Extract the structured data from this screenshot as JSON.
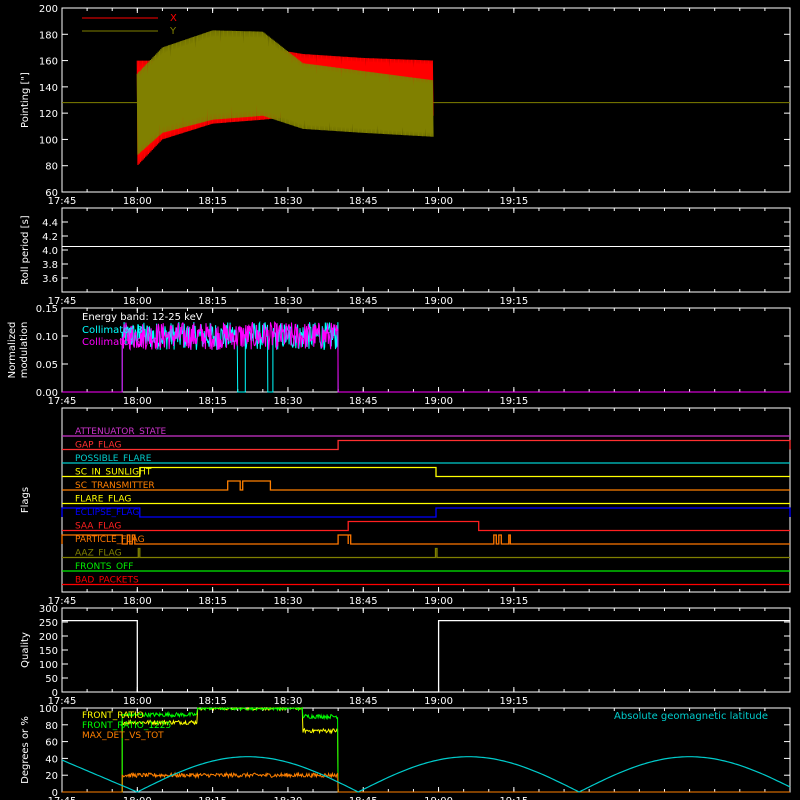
{
  "chart_data": [
    {
      "type": "line",
      "ylabel": "Pointing [\"]",
      "ylim": [
        60,
        200
      ],
      "yticks": [
        60,
        80,
        100,
        120,
        140,
        160,
        180,
        200
      ],
      "xlim_min": [
        1785,
        1930
      ],
      "x_tick_labels": [
        "17:45",
        "18:00",
        "18:15",
        "18:30",
        "18:45",
        "19:00",
        "19:15"
      ],
      "x_tick_min": [
        1785,
        1800,
        1815,
        1830,
        1845,
        1860,
        1875
      ],
      "legend_position": "top-left",
      "series": [
        {
          "name": "X",
          "color": "#ff0000",
          "time_min": [
            1800,
            1805,
            1815,
            1825,
            1833,
            1845,
            1859
          ],
          "upper": [
            160,
            160,
            176,
            170,
            165,
            162,
            160
          ],
          "lower": [
            80,
            100,
            112,
            115,
            118,
            118,
            118
          ]
        },
        {
          "name": "Y",
          "color": "#808000",
          "time_min": [
            1800,
            1805,
            1815,
            1825,
            1833,
            1845,
            1859
          ],
          "upper": [
            150,
            170,
            183,
            182,
            158,
            152,
            145
          ],
          "lower": [
            88,
            105,
            115,
            118,
            108,
            105,
            102
          ]
        }
      ],
      "reference_level": 128
    },
    {
      "type": "line",
      "ylabel": "Roll period [s]",
      "ylim": [
        3.4,
        4.6
      ],
      "yticks": [
        3.6,
        3.8,
        4.0,
        4.2,
        4.4
      ],
      "ytick_labels": [
        "3.6",
        "3.8",
        "4.0",
        "4.2",
        "4.4"
      ],
      "series": [
        {
          "name": "",
          "color": "#ffffff",
          "x": [
            1785,
            1930
          ],
          "y": [
            4.05,
            4.05
          ]
        }
      ]
    },
    {
      "type": "line",
      "ylabel": "Normalized modulation",
      "ylim": [
        0,
        0.15
      ],
      "yticks": [
        0.0,
        0.05,
        0.1,
        0.15
      ],
      "ytick_labels": [
        "0.00",
        "0.05",
        "0.10",
        "0.15"
      ],
      "annotation": "Energy band: 12-25 keV",
      "series": [
        {
          "name": "Collimator 8",
          "color": "#00ffff",
          "active": [
            [
              1797,
              1820
            ],
            [
              1821.5,
              1826
            ],
            [
              1827,
              1840
            ]
          ],
          "mean": 0.1
        },
        {
          "name": "Collimator 9",
          "color": "#ff00ff",
          "active": [
            [
              1797,
              1840
            ]
          ],
          "mean": 0.1
        }
      ]
    },
    {
      "type": "line",
      "ylabel": "Flags",
      "flags": [
        {
          "name": "ATTENUATOR_STATE",
          "color": "#cc33cc",
          "on": []
        },
        {
          "name": "GAP_FLAG",
          "color": "#ff3030",
          "on": [
            [
              1840,
              1930
            ]
          ]
        },
        {
          "name": "POSSIBLE_FLARE",
          "color": "#00cccc",
          "on": []
        },
        {
          "name": "SC_IN_SUNLIGHT",
          "color": "#ffff00",
          "on": [
            [
              1800.5,
              1859.5
            ]
          ]
        },
        {
          "name": "SC_TRANSMITTER",
          "color": "#ff8000",
          "on": [
            [
              1818,
              1820.5
            ],
            [
              1821,
              1826.5
            ]
          ]
        },
        {
          "name": "FLARE_FLAG",
          "color": "#ffff00",
          "on": []
        },
        {
          "name": "ECLIPSE_FLAG",
          "color": "#0000ff",
          "on": [
            [
              1785,
              1800.5
            ],
            [
              1859.5,
              1930
            ]
          ]
        },
        {
          "name": "SAA_FLAG",
          "color": "#ff2020",
          "on": [
            [
              1842,
              1868
            ]
          ]
        },
        {
          "name": "PARTICLE_FLAG",
          "color": "#ff7700",
          "on": [
            [
              1785,
              1797
            ],
            [
              1798,
              1798.5
            ],
            [
              1799,
              1799.5
            ],
            [
              1840,
              1842
            ],
            [
              1842,
              1842.5
            ],
            [
              1871,
              1871.5
            ],
            [
              1872,
              1872.5
            ],
            [
              1874,
              1874.3
            ]
          ]
        },
        {
          "name": "AAZ_FLAG",
          "color": "#808000",
          "on": [
            [
              1800.2,
              1800.5
            ],
            [
              1859.4,
              1859.7
            ]
          ]
        },
        {
          "name": "FRONTS_OFF",
          "color": "#00ee00",
          "on": []
        },
        {
          "name": "BAD_PACKETS",
          "color": "#ff0000",
          "on": []
        }
      ]
    },
    {
      "type": "line",
      "ylabel": "Quality",
      "ylim": [
        0,
        300
      ],
      "yticks": [
        0,
        50,
        100,
        150,
        200,
        250,
        300
      ],
      "series": [
        {
          "name": "",
          "color": "#ffffff",
          "x": [
            1785,
            1800,
            1800,
            1860,
            1860,
            1930
          ],
          "y": [
            255,
            255,
            0,
            0,
            255,
            255
          ]
        }
      ]
    },
    {
      "type": "line",
      "ylabel": "Degrees or %",
      "ylim": [
        0,
        100
      ],
      "yticks": [
        0,
        20,
        40,
        60,
        80,
        100
      ],
      "annotation": "Absolute geomagnetic latitude",
      "series": [
        {
          "name": "FRONT_RATIO",
          "color": "#ffff00",
          "x": [
            1797,
            1812,
            1812,
            1833,
            1833,
            1840
          ],
          "y": [
            83,
            83,
            100,
            100,
            73,
            73
          ],
          "noisy": true
        },
        {
          "name": "FRONT_RATIO_1225",
          "color": "#00ff00",
          "x": [
            1797,
            1812,
            1812,
            1833,
            1833,
            1840
          ],
          "y": [
            92,
            92,
            100,
            100,
            90,
            90
          ],
          "noisy": true
        },
        {
          "name": "MAX_DET_VS_TOT",
          "color": "#ff8000",
          "x": [
            1797,
            1840
          ],
          "y": [
            20,
            20
          ],
          "noisy": true
        },
        {
          "name": "Absolute geomagnetic latitude",
          "color": "#00cccc",
          "x": [
            1785,
            1800,
            1822,
            1844,
            1866,
            1888,
            1910,
            1930
          ],
          "y": [
            38,
            0,
            42,
            0,
            42,
            0,
            42,
            5
          ],
          "shape": "abs-sine"
        }
      ]
    }
  ]
}
